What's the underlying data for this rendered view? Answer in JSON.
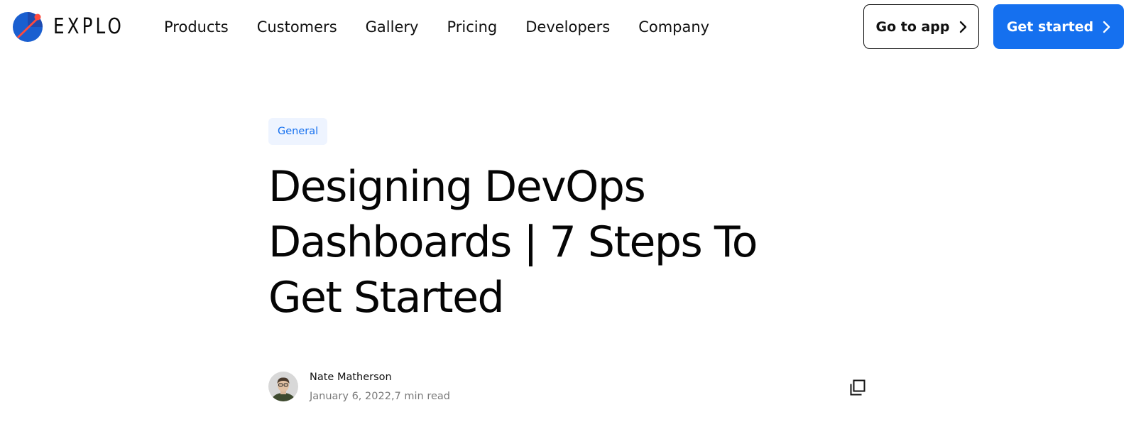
{
  "header": {
    "logo_text": "EXPLO",
    "nav": [
      {
        "label": "Products"
      },
      {
        "label": "Customers"
      },
      {
        "label": "Gallery"
      },
      {
        "label": "Pricing"
      },
      {
        "label": "Developers"
      },
      {
        "label": "Company"
      }
    ],
    "go_to_app_label": "Go to app",
    "get_started_label": "Get started"
  },
  "article": {
    "category": "General",
    "title": "Designing DevOps Dashboards | 7 Steps To Get Started",
    "author": "Nate Matherson",
    "date": "January 6, 2022",
    "read_time": "7 min read",
    "date_read_separator": ","
  },
  "icons": {
    "logo": "explo-logo-icon",
    "button_arrow": "chevron-right-icon",
    "copy": "copy-link-icon"
  },
  "colors": {
    "accent": "#1570ef",
    "tag_background": "#eef4ff",
    "logo_blue": "#1565c0",
    "logo_red": "#ff4a3d",
    "meta_text": "#7a7a7a"
  }
}
